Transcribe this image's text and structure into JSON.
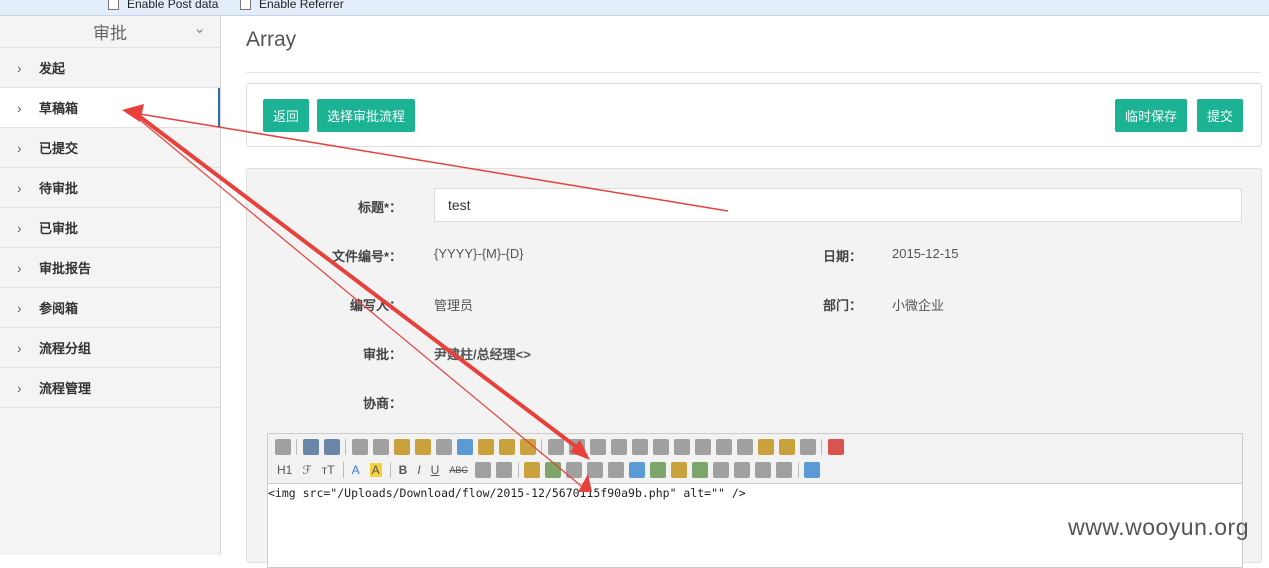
{
  "topbar": {
    "post_data_label": "Enable Post data",
    "referrer_label": "Enable Referrer"
  },
  "sidebar": {
    "header": "审批",
    "items": [
      {
        "label": "发起"
      },
      {
        "label": "草稿箱"
      },
      {
        "label": "已提交"
      },
      {
        "label": "待审批"
      },
      {
        "label": "已审批"
      },
      {
        "label": "审批报告"
      },
      {
        "label": "参阅箱"
      },
      {
        "label": "流程分组"
      },
      {
        "label": "流程管理"
      }
    ]
  },
  "page": {
    "title": "Array"
  },
  "buttons": {
    "back": "返回",
    "choose_flow": "选择审批流程",
    "temp_save": "临时保存",
    "submit": "提交"
  },
  "form": {
    "title_label": "标题*：",
    "title_value": "test",
    "docno_label": "文件编号*：",
    "docno_value": "{YYYY}-{M}-{D}",
    "date_label": "日期：",
    "date_value": "2015-12-15",
    "author_label": "编写人：",
    "author_value": "管理员",
    "dept_label": "部门：",
    "dept_value": "小微企业",
    "approve_label": "审批：",
    "approve_value": "尹建柱/总经理<>",
    "consult_label": "协商："
  },
  "editor": {
    "toolbar_text": {
      "h1": "H1",
      "font": "ℱ",
      "size": "тT",
      "font_color": "A",
      "bg_color": "A",
      "bold": "B",
      "italic": "I",
      "underline": "U",
      "strike": "ABC"
    },
    "content": "<img src=\"/Uploads/Download/flow/2015-12/5670115f90a9b.php\" alt=\"\" />"
  },
  "watermark": "www.wooyun.org",
  "colors": {
    "accent": "#1bb394",
    "annotation": "#e8403a",
    "active_border": "#2f6fb6"
  }
}
